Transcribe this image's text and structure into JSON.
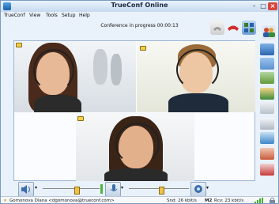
{
  "window": {
    "title": "TrueConf Online"
  },
  "menu": {
    "items": [
      {
        "label": "TrueConf",
        "u": ""
      },
      {
        "label": "View",
        "u": "V"
      },
      {
        "label": "Tools",
        "u": "T"
      },
      {
        "label": "Setup",
        "u": "S"
      },
      {
        "label": "Help",
        "u": "H"
      }
    ]
  },
  "conference": {
    "status": "Conference in progress 00:00:13"
  },
  "status_bar": {
    "user": "Gomonova Diana <dgomonova@trueconf.com>",
    "snd": "Snd: 26 kbit/s",
    "rcv_prefix": "Rcv: 23 kbit/s",
    "m2": "M2"
  },
  "colors": {
    "accent": "#1c5ea8",
    "close": "#d9463c",
    "signal": "#3fae29"
  }
}
